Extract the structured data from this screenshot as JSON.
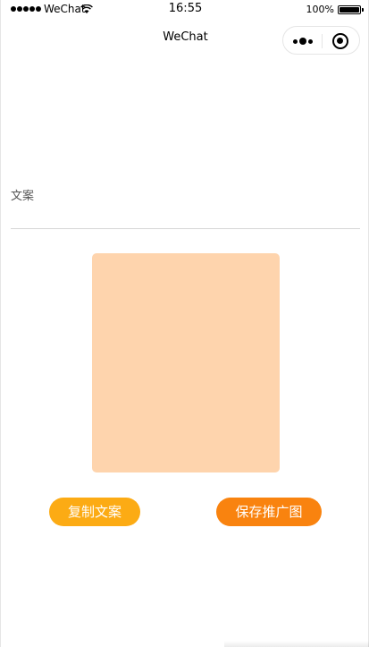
{
  "status_bar": {
    "carrier": "WeChat",
    "time": "16:55",
    "battery": "100%"
  },
  "nav": {
    "title": "WeChat",
    "icons": [
      "more-icon",
      "close-icon"
    ]
  },
  "content": {
    "copy_label": "文案",
    "copy_value": ""
  },
  "actions": {
    "copy_button": "复制文案",
    "save_button": "保存推广图"
  },
  "colors": {
    "poster_placeholder": "#fed4ad",
    "copy_button": "#fcab14",
    "save_button": "#f9830f"
  }
}
